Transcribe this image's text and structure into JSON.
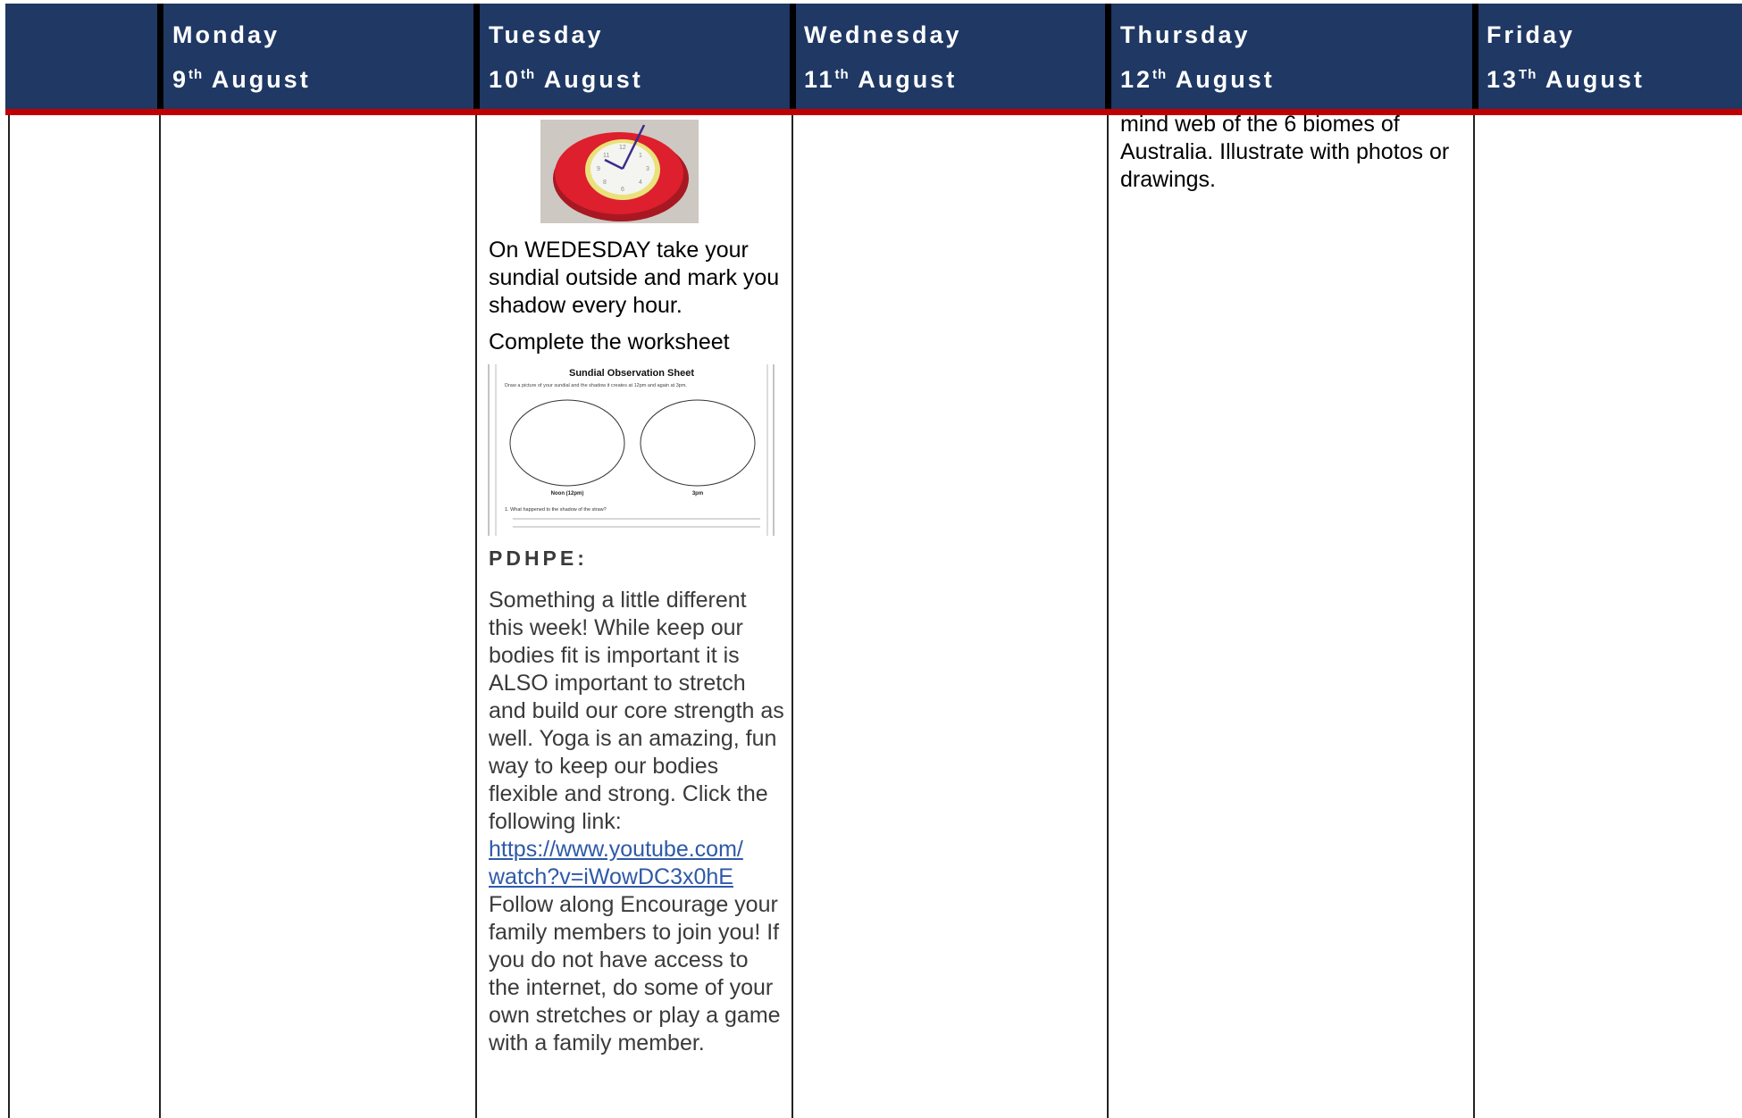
{
  "header": {
    "days": [
      {
        "name": "Monday",
        "num": "9",
        "suffix": "th",
        "month": "August"
      },
      {
        "name": "Tuesday",
        "num": "10",
        "suffix": "th",
        "month": "August"
      },
      {
        "name": "Wednesday",
        "num": "11",
        "suffix": "th",
        "month": "August"
      },
      {
        "name": "Thursday",
        "num": "12",
        "suffix": "th",
        "month": "August"
      },
      {
        "name": "Friday",
        "num": "13",
        "suffix": "Th",
        "month": "August"
      }
    ]
  },
  "tuesday": {
    "sundial_text": "On WEDESDAY take your sundial outside and mark you shadow every hour.",
    "worksheet_text": "Complete the worksheet",
    "worksheet": {
      "title": "Sundial Observation Sheet",
      "instruction": "Draw a picture of your sundial and the shadow it creates at 12pm and again at 3pm.",
      "left_label": "Noon (12pm)",
      "right_label": "3pm",
      "question": "1.   What happened to the shadow of the straw?"
    },
    "pdhpe_heading": "PDHPE:",
    "pdhpe_text": "Something a little different this week! While keep our bodies fit is important it is ALSO important to stretch and build our core strength as well. Yoga is an amazing, fun way to keep our bodies flexible and strong. Click the following link:",
    "link_line1": "https://www.youtube.com/",
    "link_line2": "watch?v=iWowDC3x0hE",
    "pdhpe_follow": "Follow along Encourage your family members to join you! If you do not have access to the internet, do some of your own stretches or play a game with a family member."
  },
  "thursday": {
    "text": "mind web of the 6 biomes of Australia. Illustrate with photos or drawings."
  }
}
